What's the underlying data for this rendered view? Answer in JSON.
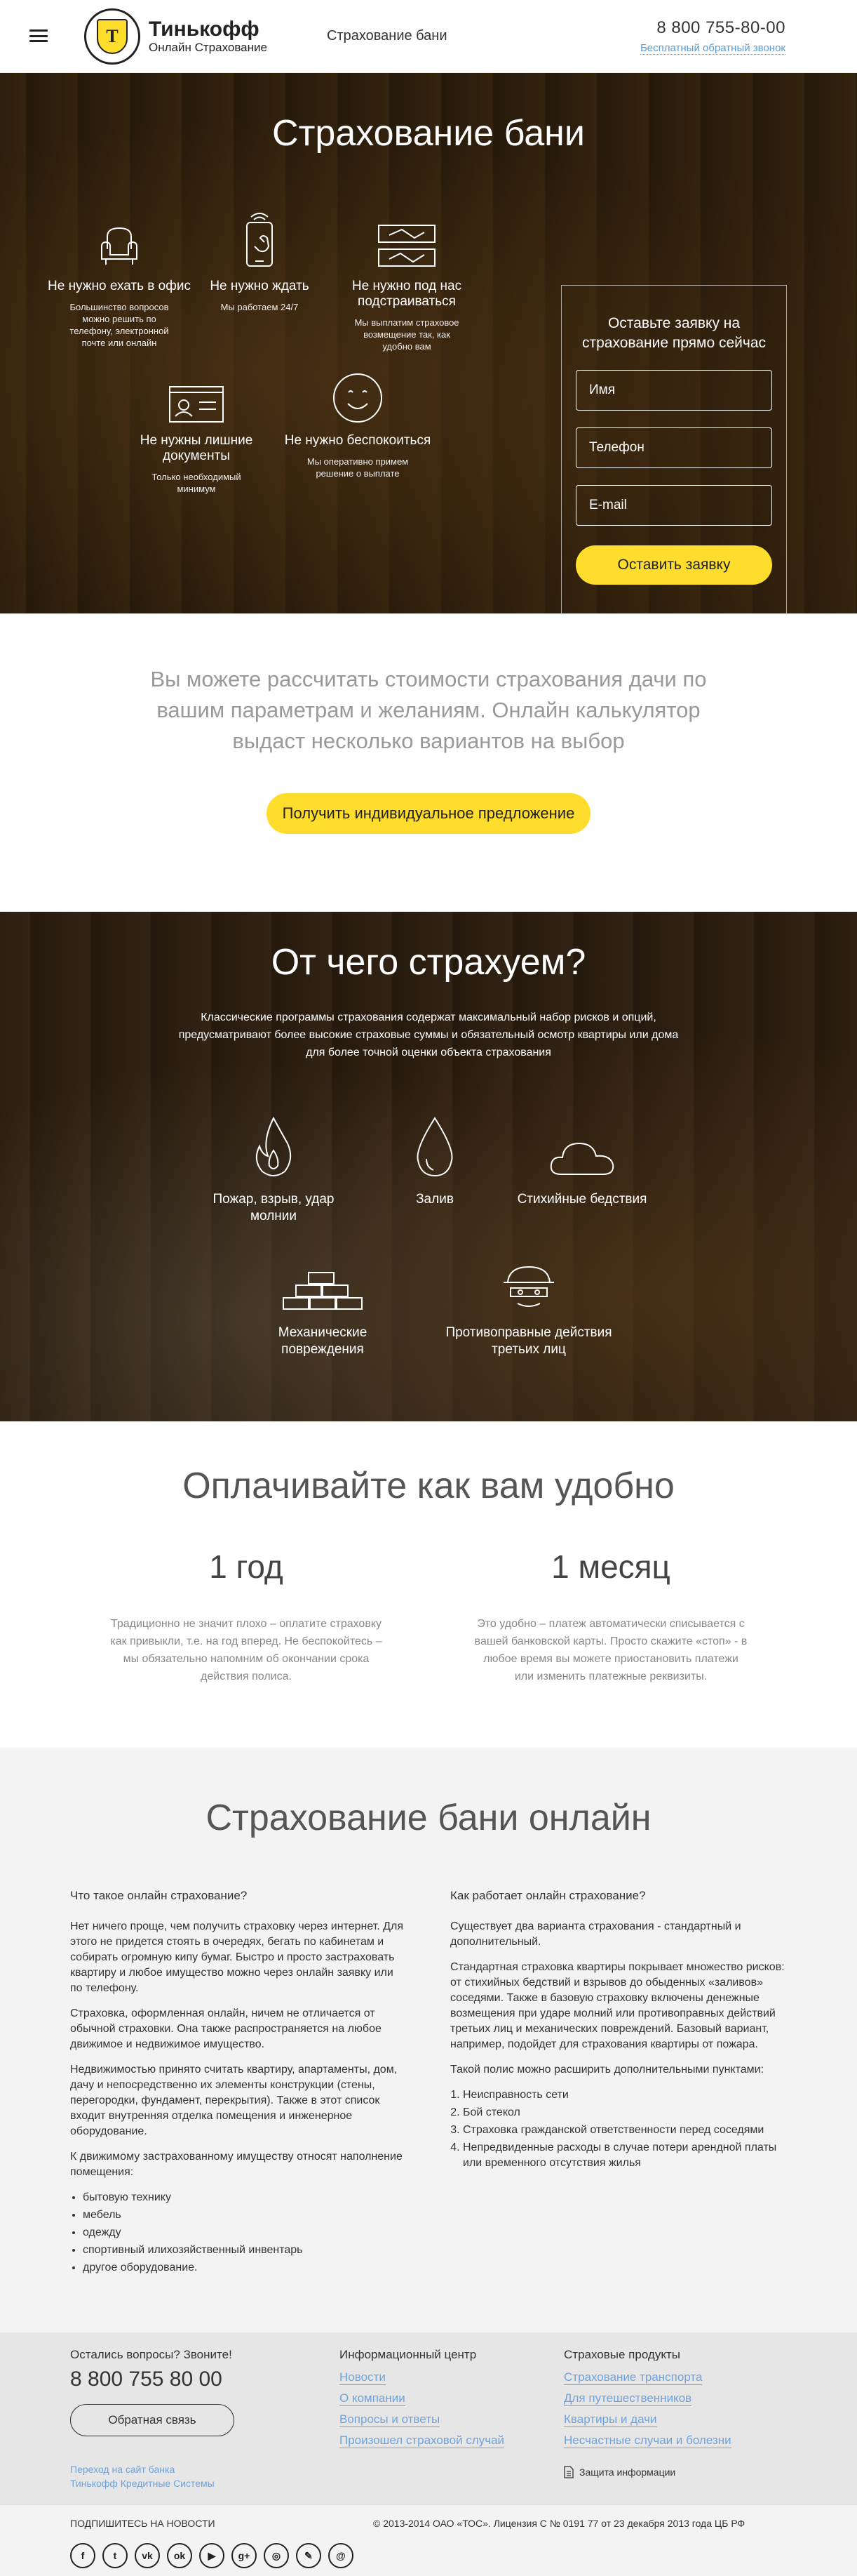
{
  "header": {
    "logo_name": "Тинькофф",
    "logo_sub": "Онлайн Страхование",
    "nav_title": "Страхование бани",
    "phone": "8 800 755-80-00",
    "callback_link": "Бесплатный обратный звонок"
  },
  "hero": {
    "title": "Страхование бани",
    "features": [
      {
        "title": "Не нужно ехать в офис",
        "desc": "Большинство вопросов можно решить по телефону, электронной почте или онлайн",
        "icon": "armchair-icon"
      },
      {
        "title": "Не нужно ждать",
        "desc": "Мы работаем 24/7",
        "icon": "phone-icon"
      },
      {
        "title": "Не нужно под нас подстраиваться",
        "desc": "Мы выплатим страховое возмещение так, как удобно вам",
        "icon": "cards-icon"
      },
      {
        "title": "Не нужны лишние документы",
        "desc": "Только необходимый минимум",
        "icon": "id-card-icon"
      },
      {
        "title": "Не нужно беспокоиться",
        "desc": "Мы оперативно примем решение о выплате",
        "icon": "smile-icon"
      }
    ],
    "form": {
      "title": "Оставьте заявку на страхование прямо сейчас",
      "name_placeholder": "Имя",
      "phone_placeholder": "Телефон",
      "email_placeholder": "E-mail",
      "submit_label": "Оставить заявку"
    }
  },
  "calc": {
    "text": "Вы можете рассчитать стоимости страхования дачи по вашим параметрам и желаниям. Онлайн калькулятор выдаст несколько вариантов на выбор",
    "button_label": "Получить индивидуальное предложение"
  },
  "risks": {
    "title": "От чего страхуем?",
    "text": "Классические программы страхования содержат максимальный набор рисков и опций, предусматривают более высокие страховые суммы и обязательный осмотр квартиры или дома для более точной оценки объекта страхования",
    "items": [
      {
        "title": "Пожар, взрыв, удар молнии",
        "icon": "fire-icon"
      },
      {
        "title": "Залив",
        "icon": "water-drop-icon"
      },
      {
        "title": "Стихийные бедствия",
        "icon": "cloud-icon"
      },
      {
        "title": "Механические повреждения",
        "icon": "bricks-icon"
      },
      {
        "title": "Противоправные действия третьих лиц",
        "icon": "thief-icon"
      }
    ]
  },
  "payment": {
    "title": "Оплачивайте как вам удобно",
    "options": [
      {
        "title": "1 год",
        "text": "Традиционно не значит плохо – оплатите страховку как привыкли, т.е. на год вперед. Не беспокойтесь – мы обязательно напомним об окончании срока действия полиса."
      },
      {
        "title": "1 месяц",
        "text": "Это удобно – платеж автоматически списывается с вашей банковской карты. Просто скажите «стоп» - в любое время вы можете приостановить платежи или изменить платежные реквизиты."
      }
    ]
  },
  "info": {
    "title": "Страхование бани онлайн",
    "left": {
      "heading": "Что такое онлайн страхование?",
      "p1": "Нет ничего проще, чем получить страховку через интернет. Для этого не придется стоять в очередях, бегать по кабинетам и собирать огромную кипу бумаг. Быстро и просто застраховать квартиру и любое имущество можно через онлайн заявку или по телефону.",
      "p2": "Страховка, оформленная онлайн, ничем не отличается от обычной страховки. Она также распространяется на любое движимое и недвижимое имущество.",
      "p3": "Недвижимостью принято считать квартиру, апартаменты, дом, дачу и непосредственно их элементы конструкции (стены, перегородки, фундамент, перекрытия). Также в этот список входит внутренняя отделка помещения и инженерное оборудование.",
      "p4": "К движимому застрахованному имуществу относят наполнение помещения:",
      "list": [
        "бытовую технику",
        "мебель",
        "одежду",
        "спортивный илихозяйственный инвентарь",
        "другое оборудование."
      ]
    },
    "right": {
      "heading": "Как работает онлайн страхование?",
      "p1": "Существует два варианта страхования - стандартный и дополнительный.",
      "p2": "Стандартная страховка квартиры покрывает множество рисков: от стихийных бедствий и взрывов до обыденных «заливов» соседями. Также в базовую страховку включены денежные возмещения при ударе молний или противоправных действий третьих лиц и механических повреждений. Базовый вариант, например, подойдет для страхования квартиры от пожара.",
      "p3": "Такой полис можно расширить дополнительными пунктами:",
      "list": [
        "Неисправность сети",
        "Бой стекол",
        "Страховка гражданской ответственности перед соседями",
        "Непредвиденные расходы в случае потери арендной платы или временного отсутствия жилья"
      ]
    }
  },
  "footer": {
    "questions": "Остались вопросы? Звоните!",
    "phone": "8 800 755 80 00",
    "feedback": "Обратная связь",
    "info_heading": "Информационный центр",
    "info_links": [
      "Новости",
      "О компании",
      "Вопросы и ответы",
      "Произошел страховой случай"
    ],
    "products_heading": "Страховые продукты",
    "product_links": [
      "Страхование транспорта",
      "Для путешественников",
      "Квартиры и дачи",
      "Несчастные случаи и болезни"
    ],
    "bank_link": "Переход на сайт банка",
    "bank_name": "Тинькофф Кредитные Системы",
    "protection": "Защита информации",
    "subscribe": "ПОДПИШИТЕСЬ НА НОВОСТИ",
    "copyright": "© 2013-2014 ОАО «ТОС». Лицензия С № 0191 77 от 23 декабря 2013 года ЦБ РФ",
    "socials": [
      {
        "name": "facebook-icon",
        "glyph": "f"
      },
      {
        "name": "twitter-icon",
        "glyph": "t"
      },
      {
        "name": "vk-icon",
        "glyph": "vk"
      },
      {
        "name": "odnoklassniki-icon",
        "glyph": "ok"
      },
      {
        "name": "youtube-icon",
        "glyph": "▶"
      },
      {
        "name": "google-plus-icon",
        "glyph": "g+"
      },
      {
        "name": "instagram-icon",
        "glyph": "◎"
      },
      {
        "name": "livejournal-icon",
        "glyph": "✎"
      },
      {
        "name": "email-icon",
        "glyph": "@"
      }
    ]
  }
}
